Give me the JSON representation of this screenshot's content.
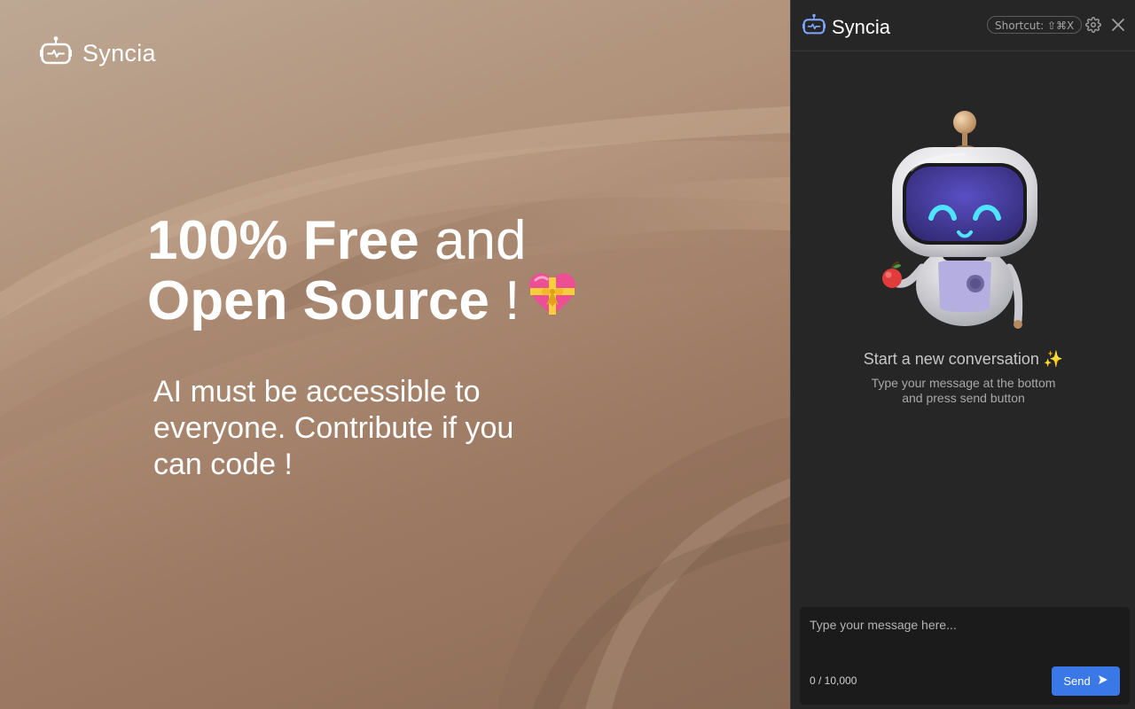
{
  "hero": {
    "brand_name": "Syncia",
    "headline_line1_bold": "100% Free",
    "headline_line1_thin": " and",
    "headline_line2_bold": "Open Source",
    "headline_line2_thin": " !",
    "subtext": "AI must be accessible to everyone. Contribute if you can code !",
    "icons": [
      "robot-logo-icon",
      "heart-gift-icon"
    ]
  },
  "panel": {
    "title": "Syncia",
    "shortcut_label": "Shortcut: ⇧⌘X",
    "empty_state": {
      "title": "Start a new conversation ✨",
      "subtitle_line1": "Type your message at the bottom",
      "subtitle_line2": "and press send button"
    },
    "composer": {
      "placeholder": "Type your message here...",
      "value": "",
      "char_count": "0 / 10,000",
      "send_label": "Send"
    },
    "icons": [
      "robot-logo-icon",
      "settings-icon",
      "close-icon",
      "send-icon",
      "robot-mascot-icon"
    ]
  },
  "colors": {
    "panel_bg": "#262626",
    "accent": "#3b78e7",
    "hero_bg": "#a98b74"
  }
}
